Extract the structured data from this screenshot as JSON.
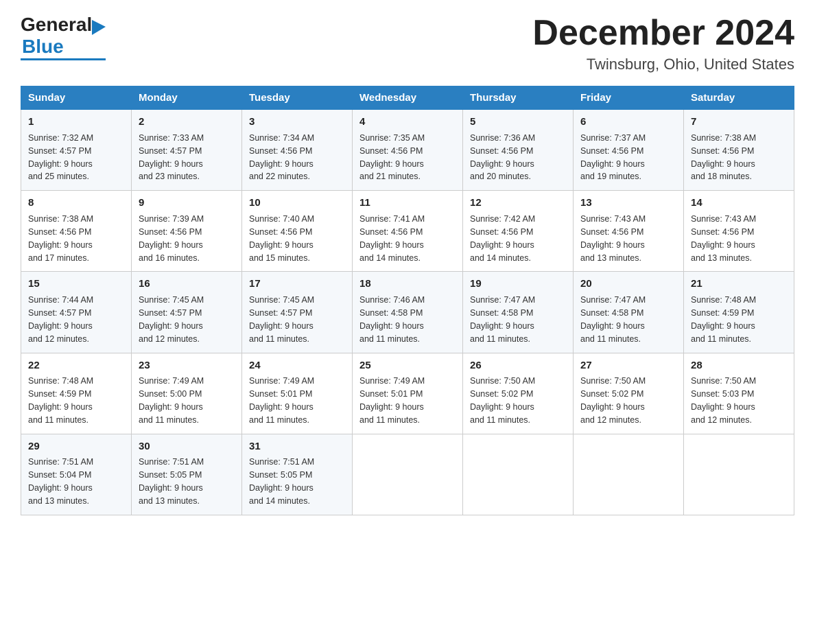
{
  "header": {
    "logo_general": "General",
    "logo_arrow": "▶",
    "logo_blue": "Blue",
    "month_title": "December 2024",
    "location": "Twinsburg, Ohio, United States"
  },
  "days_of_week": [
    "Sunday",
    "Monday",
    "Tuesday",
    "Wednesday",
    "Thursday",
    "Friday",
    "Saturday"
  ],
  "weeks": [
    [
      {
        "day": "1",
        "sunrise": "7:32 AM",
        "sunset": "4:57 PM",
        "daylight": "9 hours and 25 minutes."
      },
      {
        "day": "2",
        "sunrise": "7:33 AM",
        "sunset": "4:57 PM",
        "daylight": "9 hours and 23 minutes."
      },
      {
        "day": "3",
        "sunrise": "7:34 AM",
        "sunset": "4:56 PM",
        "daylight": "9 hours and 22 minutes."
      },
      {
        "day": "4",
        "sunrise": "7:35 AM",
        "sunset": "4:56 PM",
        "daylight": "9 hours and 21 minutes."
      },
      {
        "day": "5",
        "sunrise": "7:36 AM",
        "sunset": "4:56 PM",
        "daylight": "9 hours and 20 minutes."
      },
      {
        "day": "6",
        "sunrise": "7:37 AM",
        "sunset": "4:56 PM",
        "daylight": "9 hours and 19 minutes."
      },
      {
        "day": "7",
        "sunrise": "7:38 AM",
        "sunset": "4:56 PM",
        "daylight": "9 hours and 18 minutes."
      }
    ],
    [
      {
        "day": "8",
        "sunrise": "7:38 AM",
        "sunset": "4:56 PM",
        "daylight": "9 hours and 17 minutes."
      },
      {
        "day": "9",
        "sunrise": "7:39 AM",
        "sunset": "4:56 PM",
        "daylight": "9 hours and 16 minutes."
      },
      {
        "day": "10",
        "sunrise": "7:40 AM",
        "sunset": "4:56 PM",
        "daylight": "9 hours and 15 minutes."
      },
      {
        "day": "11",
        "sunrise": "7:41 AM",
        "sunset": "4:56 PM",
        "daylight": "9 hours and 14 minutes."
      },
      {
        "day": "12",
        "sunrise": "7:42 AM",
        "sunset": "4:56 PM",
        "daylight": "9 hours and 14 minutes."
      },
      {
        "day": "13",
        "sunrise": "7:43 AM",
        "sunset": "4:56 PM",
        "daylight": "9 hours and 13 minutes."
      },
      {
        "day": "14",
        "sunrise": "7:43 AM",
        "sunset": "4:56 PM",
        "daylight": "9 hours and 13 minutes."
      }
    ],
    [
      {
        "day": "15",
        "sunrise": "7:44 AM",
        "sunset": "4:57 PM",
        "daylight": "9 hours and 12 minutes."
      },
      {
        "day": "16",
        "sunrise": "7:45 AM",
        "sunset": "4:57 PM",
        "daylight": "9 hours and 12 minutes."
      },
      {
        "day": "17",
        "sunrise": "7:45 AM",
        "sunset": "4:57 PM",
        "daylight": "9 hours and 11 minutes."
      },
      {
        "day": "18",
        "sunrise": "7:46 AM",
        "sunset": "4:58 PM",
        "daylight": "9 hours and 11 minutes."
      },
      {
        "day": "19",
        "sunrise": "7:47 AM",
        "sunset": "4:58 PM",
        "daylight": "9 hours and 11 minutes."
      },
      {
        "day": "20",
        "sunrise": "7:47 AM",
        "sunset": "4:58 PM",
        "daylight": "9 hours and 11 minutes."
      },
      {
        "day": "21",
        "sunrise": "7:48 AM",
        "sunset": "4:59 PM",
        "daylight": "9 hours and 11 minutes."
      }
    ],
    [
      {
        "day": "22",
        "sunrise": "7:48 AM",
        "sunset": "4:59 PM",
        "daylight": "9 hours and 11 minutes."
      },
      {
        "day": "23",
        "sunrise": "7:49 AM",
        "sunset": "5:00 PM",
        "daylight": "9 hours and 11 minutes."
      },
      {
        "day": "24",
        "sunrise": "7:49 AM",
        "sunset": "5:01 PM",
        "daylight": "9 hours and 11 minutes."
      },
      {
        "day": "25",
        "sunrise": "7:49 AM",
        "sunset": "5:01 PM",
        "daylight": "9 hours and 11 minutes."
      },
      {
        "day": "26",
        "sunrise": "7:50 AM",
        "sunset": "5:02 PM",
        "daylight": "9 hours and 11 minutes."
      },
      {
        "day": "27",
        "sunrise": "7:50 AM",
        "sunset": "5:02 PM",
        "daylight": "9 hours and 12 minutes."
      },
      {
        "day": "28",
        "sunrise": "7:50 AM",
        "sunset": "5:03 PM",
        "daylight": "9 hours and 12 minutes."
      }
    ],
    [
      {
        "day": "29",
        "sunrise": "7:51 AM",
        "sunset": "5:04 PM",
        "daylight": "9 hours and 13 minutes."
      },
      {
        "day": "30",
        "sunrise": "7:51 AM",
        "sunset": "5:05 PM",
        "daylight": "9 hours and 13 minutes."
      },
      {
        "day": "31",
        "sunrise": "7:51 AM",
        "sunset": "5:05 PM",
        "daylight": "9 hours and 14 minutes."
      },
      null,
      null,
      null,
      null
    ]
  ],
  "labels": {
    "sunrise": "Sunrise:",
    "sunset": "Sunset:",
    "daylight": "Daylight:"
  }
}
